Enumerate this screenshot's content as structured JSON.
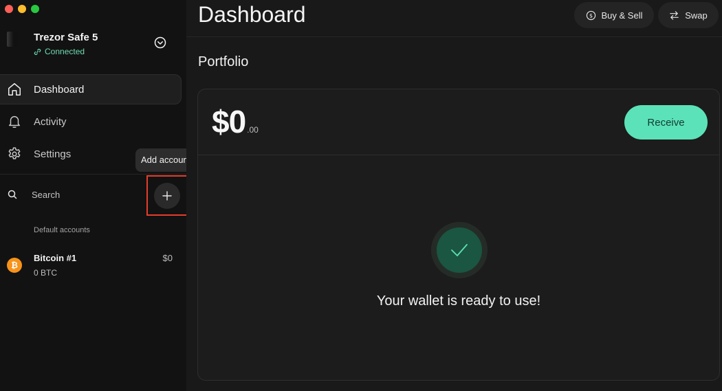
{
  "device": {
    "name": "Trezor Safe 5",
    "status": "Connected"
  },
  "nav": [
    {
      "label": "Dashboard",
      "icon": "home-icon",
      "active": true
    },
    {
      "label": "Activity",
      "icon": "bell-icon",
      "active": false
    },
    {
      "label": "Settings",
      "icon": "gear-icon",
      "active": false
    }
  ],
  "search": {
    "label": "Search"
  },
  "add_account": {
    "tooltip": "Add account",
    "icon": "plus-icon"
  },
  "accounts": {
    "group_label": "Default accounts",
    "items": [
      {
        "name": "Bitcoin #1",
        "balance": "0 BTC",
        "fiat": "$0",
        "icon": "bitcoin-icon",
        "color": "#f7931a"
      }
    ]
  },
  "header": {
    "title": "Dashboard",
    "buy_sell": "Buy & Sell",
    "swap": "Swap"
  },
  "portfolio": {
    "title": "Portfolio",
    "amount": "$0",
    "cents": ".00",
    "receive": "Receive",
    "message": "Your wallet is ready to use!"
  },
  "colors": {
    "accent": "#5ce2b8",
    "connected": "#6ddcb2",
    "highlight": "#e63d2b"
  }
}
